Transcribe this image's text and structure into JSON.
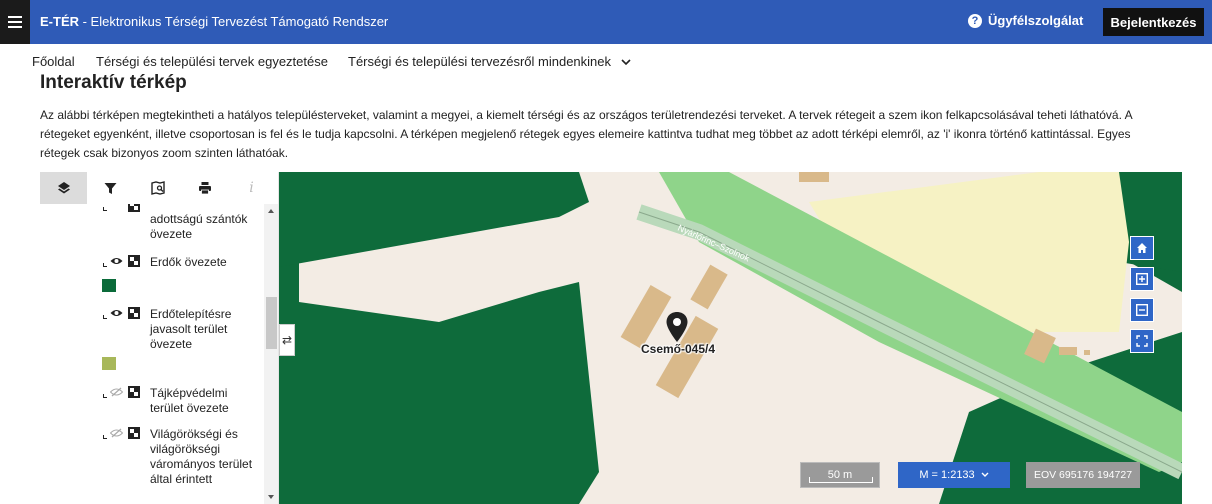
{
  "header": {
    "brand": "E-TÉR",
    "title_rest": " - Elektronikus Térségi Tervezést Támogató Rendszer",
    "support_label": "Ügyfélszolgálat",
    "login_label": "Bejelentkezés"
  },
  "nav": {
    "items": [
      {
        "label": "Főoldal"
      },
      {
        "label": "Térségi és települési tervek egyeztetése"
      },
      {
        "label": "Térségi és települési tervezésről mindenkinek"
      }
    ]
  },
  "page": {
    "title": "Interaktív térkép",
    "description": "Az alábbi térképen megtekintheti a hatályos településterveket, valamint a megyei, a kiemelt térségi és az országos területrendezési terveket. A tervek rétegeit a szem ikon felkapcsolásával teheti láthatóvá. A rétegeket egyenként, illetve csoportosan is fel és le tudja kapcsolni. A térképen megjelenő rétegek egyes elemeire kattintva tudhat meg többet az adott térképi elemről, az 'i' ikonra történő kattintással. Egyes rétegek csak bizonyos zoom szinten láthatóak."
  },
  "panel": {
    "tabs": [
      {
        "icon": "layers-icon"
      },
      {
        "icon": "filter-icon"
      },
      {
        "icon": "map-search-icon"
      },
      {
        "icon": "print-icon"
      },
      {
        "icon": "info-icon",
        "glyph": "i"
      }
    ],
    "layers": [
      {
        "label": "adottságú szántók övezete",
        "visible": true
      },
      {
        "label": "Erdők övezete",
        "visible": true,
        "swatch": "#0b6b3a"
      },
      {
        "label": "Erdőtelepítésre javasolt terület övezete",
        "visible": true,
        "swatch": "#a8b85a"
      },
      {
        "label": "Tájképvédelmi terület övezete",
        "visible": false
      },
      {
        "label": "Világörökségi és világörökségi várományos terület által érintett",
        "visible": false
      }
    ],
    "toggle_glyph": "⇄"
  },
  "map": {
    "colors": {
      "forest": "#0e6b3b",
      "base": "#f3ece4",
      "arable": "#f6f2c4",
      "green": "#8fd48a",
      "building": "#d9b98a",
      "rail": "#b9d9ba"
    },
    "road_label": "Nyárlőrinc–Szolnok",
    "parcel_label": "Csemő-045/4",
    "scale_label": "50 m",
    "zoom_label": "M = 1:2133",
    "coords_label": "EOV  695176 194727",
    "controls": [
      {
        "name": "home"
      },
      {
        "name": "zoom-in"
      },
      {
        "name": "zoom-out"
      },
      {
        "name": "fullscreen"
      }
    ]
  }
}
